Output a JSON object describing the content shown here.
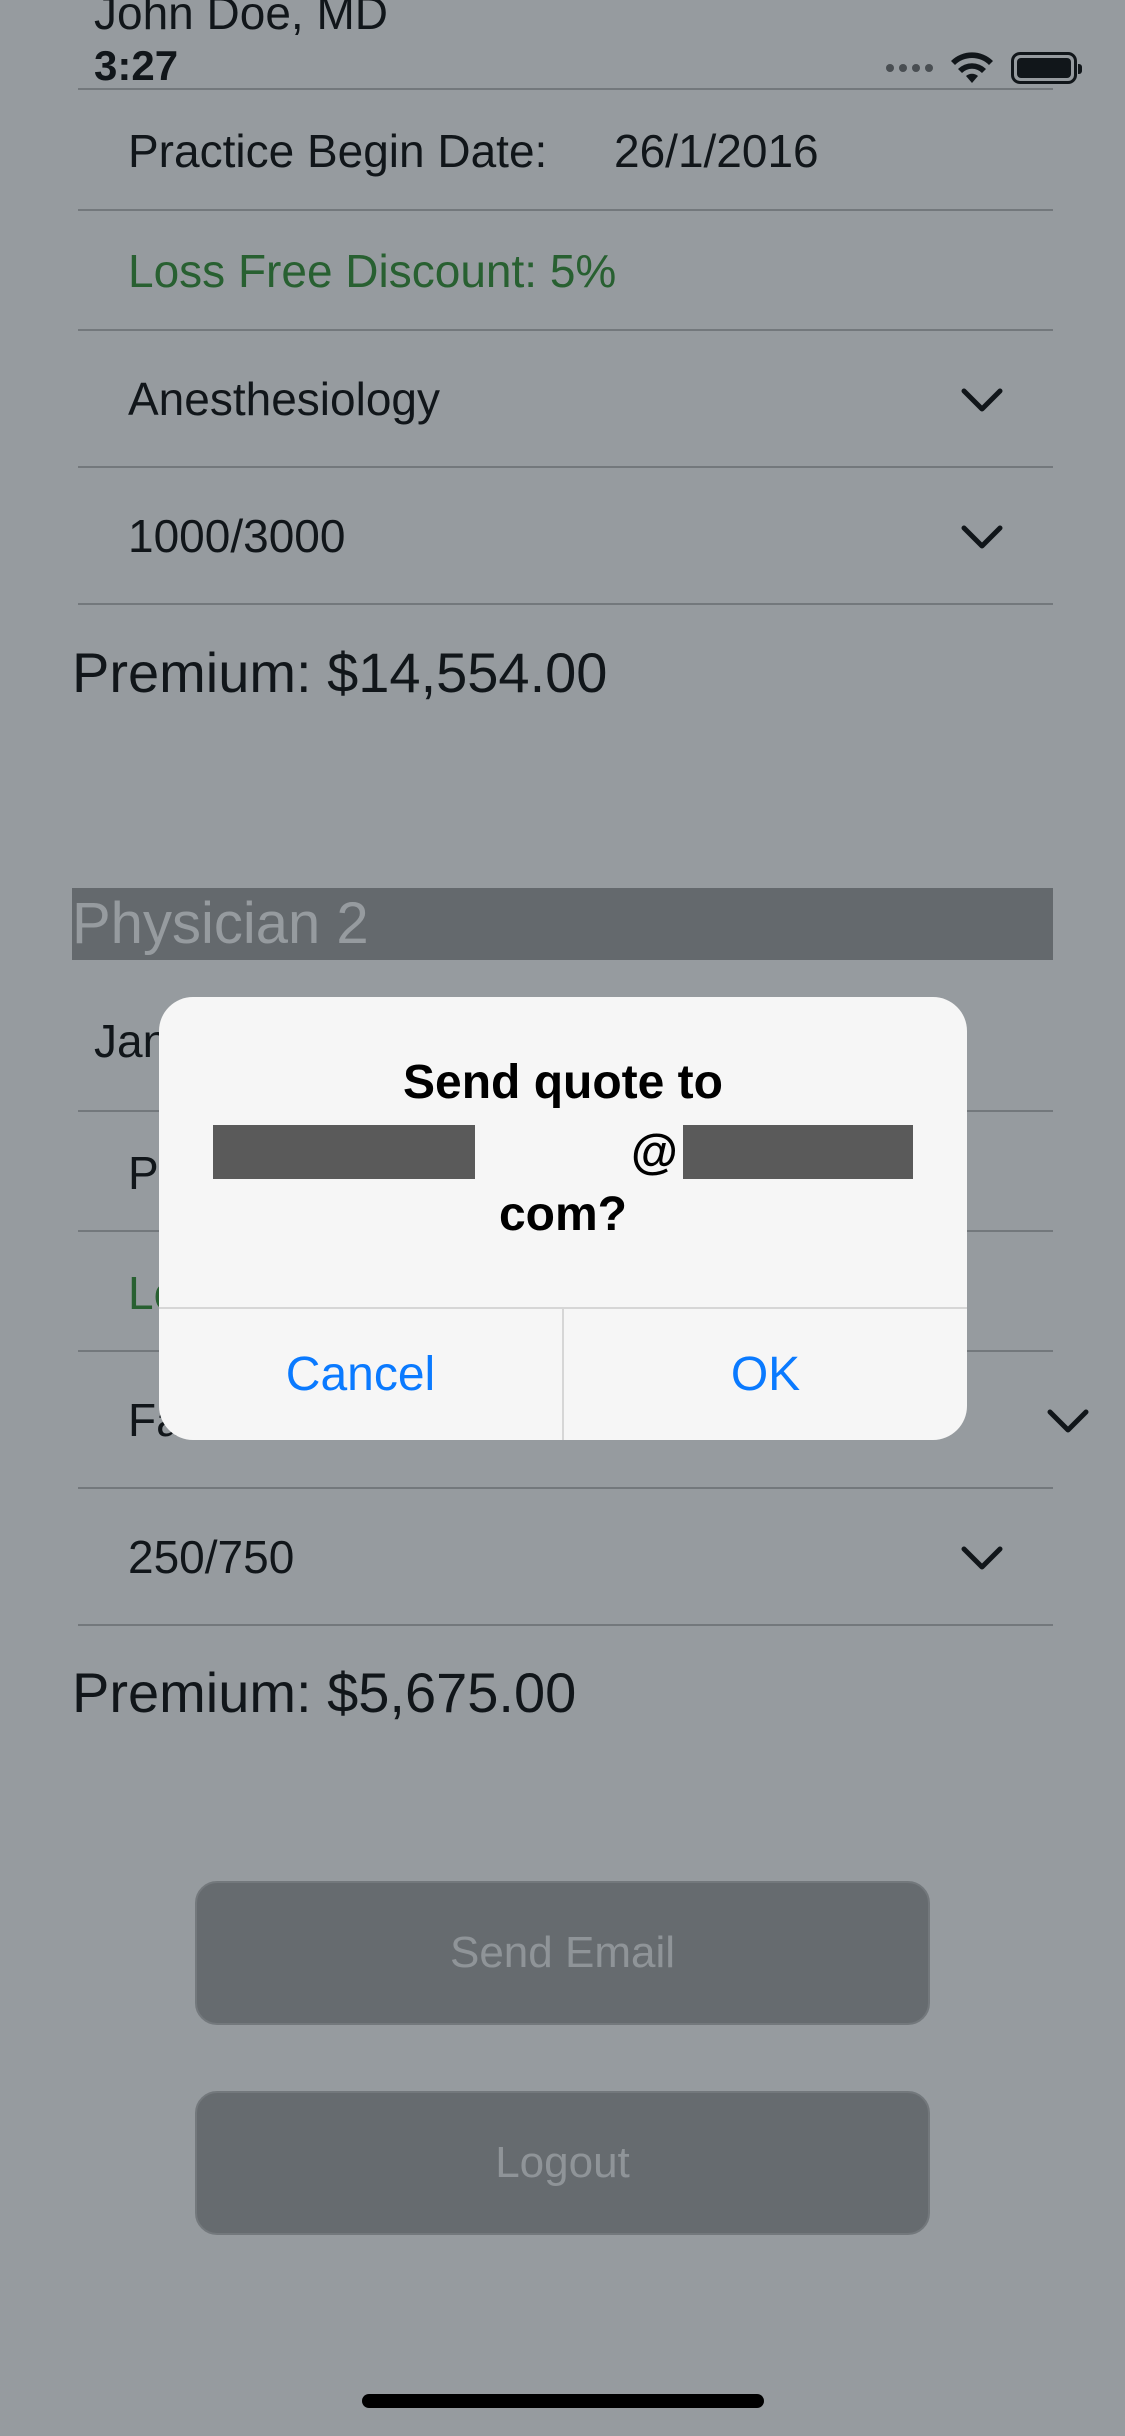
{
  "header": {
    "name": "John Doe, MD",
    "time": "3:27"
  },
  "physician1": {
    "practice_label": "Practice Begin Date:",
    "practice_date": "26/1/2016",
    "discount": "Loss Free Discount: 5%",
    "specialty": "Anesthesiology",
    "limits": "1000/3000",
    "premium": "Premium: $14,554.00"
  },
  "physician2": {
    "section_title": "Physician 2",
    "name_partial": "Jan",
    "practice_partial": "P",
    "discount_partial": "Lo",
    "specialty_partial": "Fa",
    "limits": "250/750",
    "premium": "Premium: $5,675.00"
  },
  "buttons": {
    "send_email": "Send Email",
    "logout": "Logout"
  },
  "alert": {
    "title": "Send quote to",
    "email_at": "@",
    "email_tail": "com?",
    "cancel": "Cancel",
    "ok": "OK"
  },
  "colors": {
    "accent_blue": "#0a7aff",
    "discount_green": "#2d8f2d",
    "section_bar": "#a0a0a0"
  }
}
